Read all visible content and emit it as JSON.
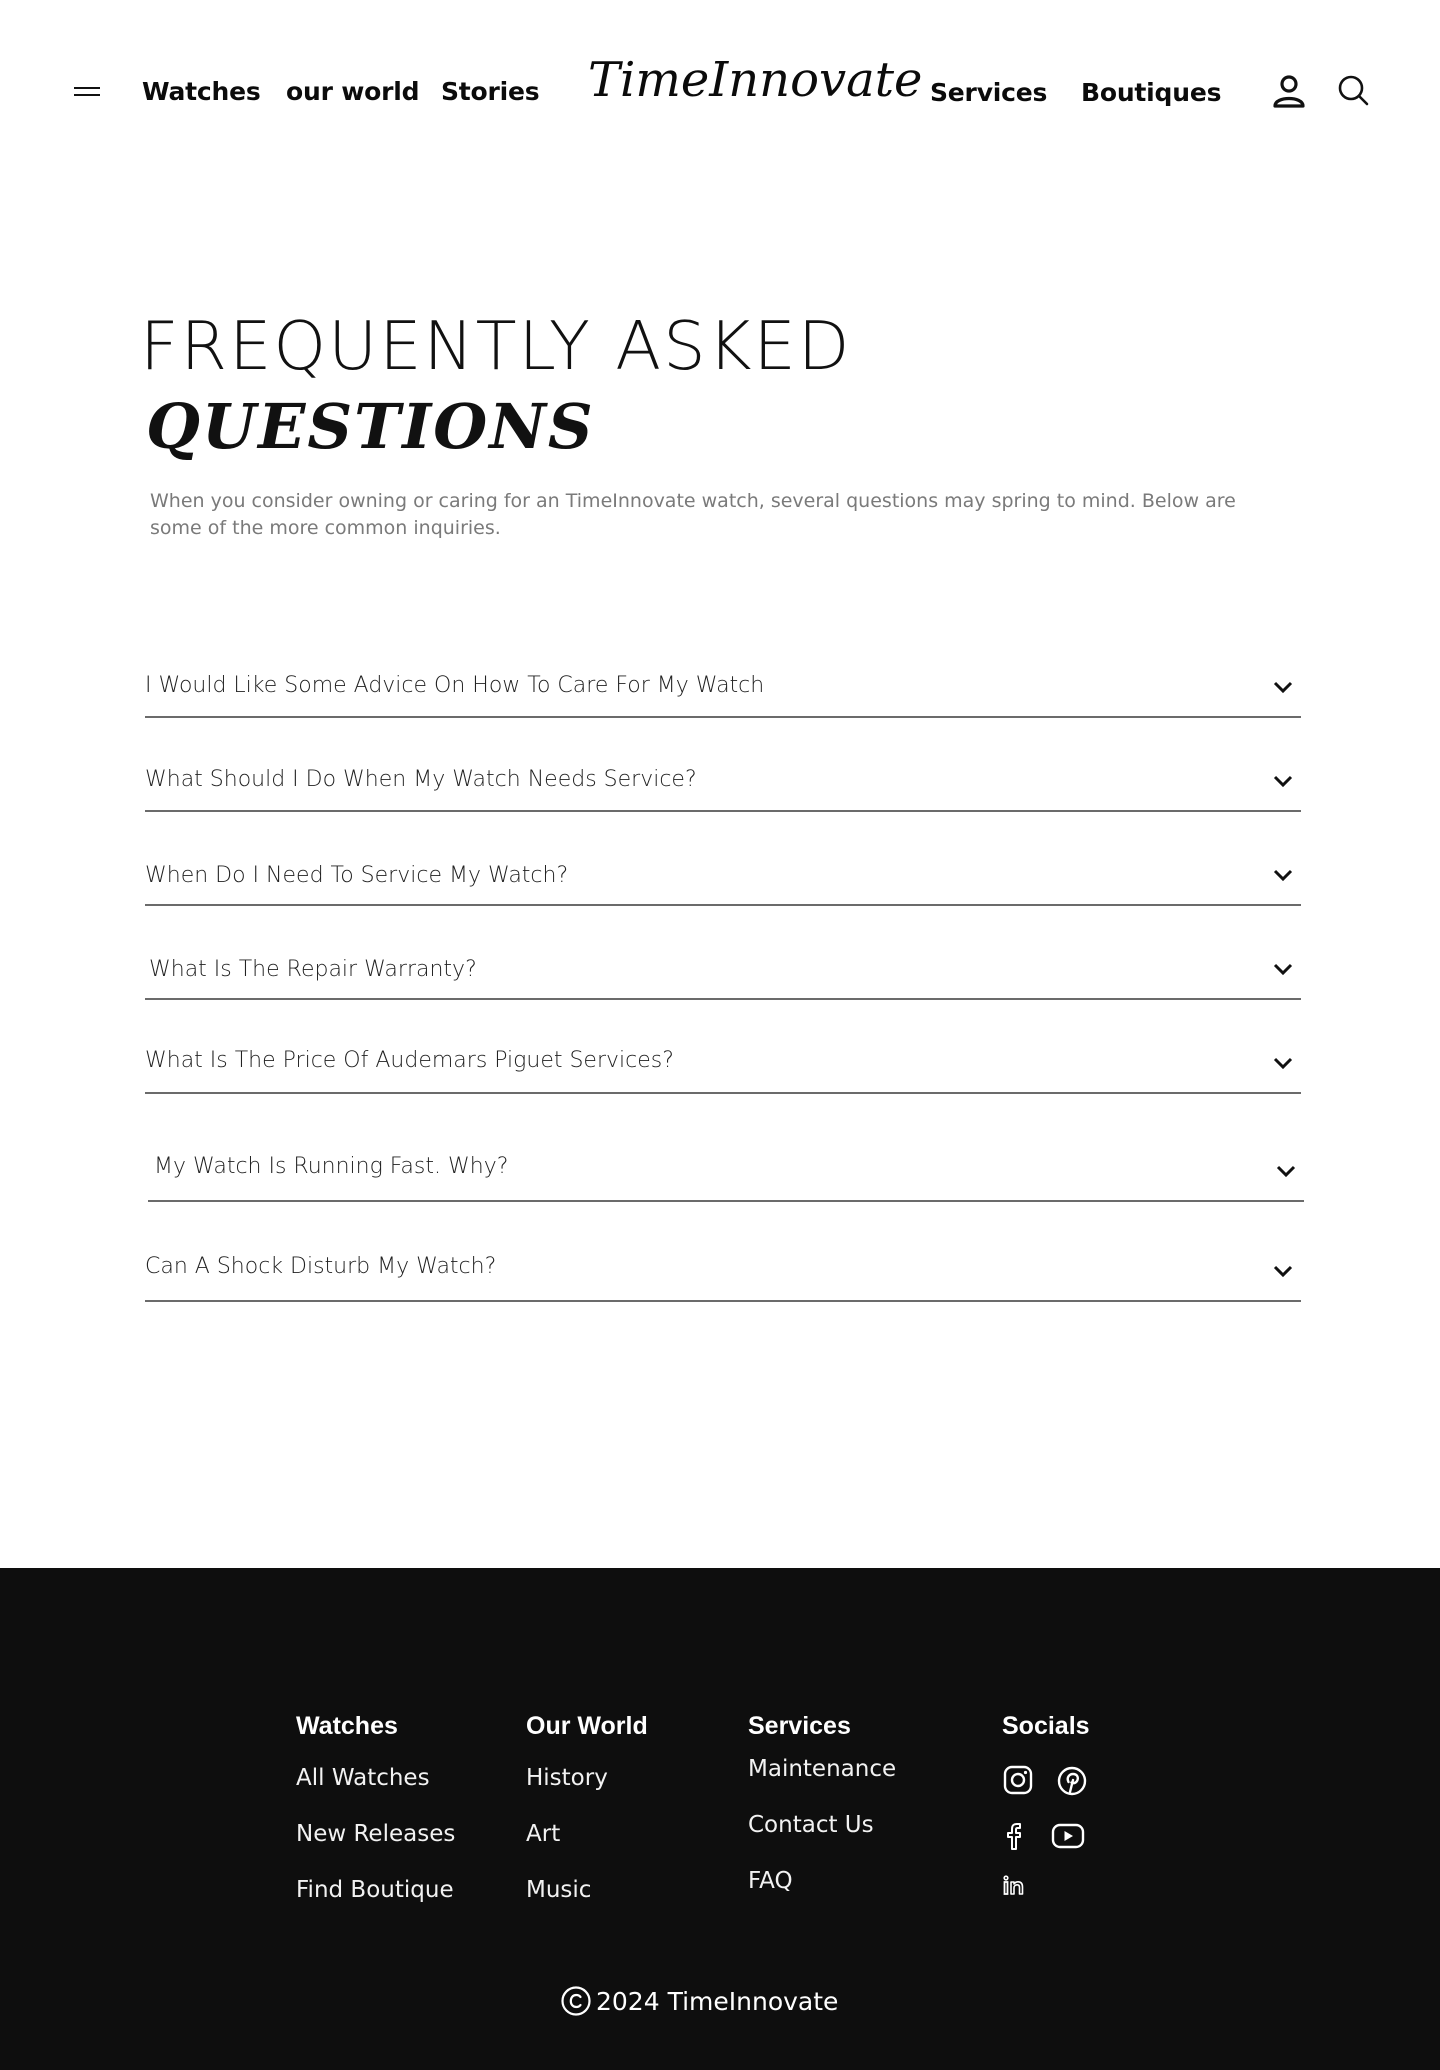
{
  "header": {
    "menu_icon": "hamburger-menu-icon",
    "nav_left": [
      "Watches",
      "our world",
      "Stories"
    ],
    "brand": "TimeInnovate",
    "nav_right": [
      "Services",
      "Boutiques"
    ],
    "account_icon": "user-icon",
    "search_icon": "search-icon"
  },
  "hero": {
    "title_line1": "FREQUENTLY ASKED",
    "title_line2": "QUESTIONS",
    "intro": "When you consider owning or caring for an TimeInnovate watch, several questions may spring to mind. Below are some of the more common inquiries."
  },
  "faq": {
    "items": [
      "I Would Like Some Advice On How To Care For My Watch",
      "What Should I Do When My Watch Needs Service?",
      "When Do I Need To Service My Watch?",
      "What Is The Repair Warranty?",
      "What Is The Price Of Audemars Piguet Services?",
      "My Watch Is Running Fast. Why?",
      "Can A Shock Disturb My Watch?"
    ],
    "expand_icon": "chevron-down-icon"
  },
  "footer": {
    "columns": [
      {
        "title": "Watches",
        "links": [
          "All Watches",
          "New Releases",
          "Find Boutique"
        ]
      },
      {
        "title": "Our World",
        "links": [
          "History",
          "Art",
          "Music"
        ]
      },
      {
        "title": "Services",
        "links": [
          "Maintenance",
          "Contact Us",
          "FAQ"
        ]
      }
    ],
    "socials_title": "Socials",
    "socials": [
      "instagram-icon",
      "pinterest-icon",
      "facebook-icon",
      "youtube-icon",
      "linkedin-icon"
    ],
    "copyright_icon": "copyright-icon",
    "copyright": "2024 TimeInnovate"
  },
  "colors": {
    "background": "#ffffff",
    "text": "#111111",
    "muted_text": "#7a7a7a",
    "divider": "#6b6b6b",
    "footer_bg": "#0e0e0e",
    "footer_text": "#ffffff"
  }
}
